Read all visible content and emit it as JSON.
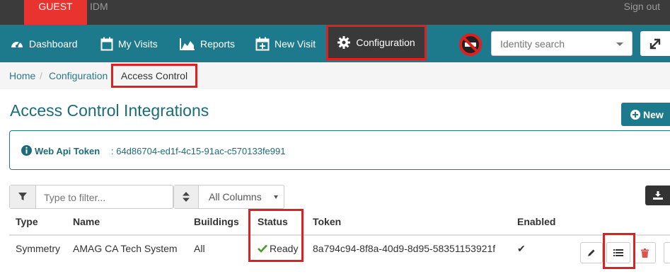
{
  "topbar": {
    "tabs": [
      "GUEST",
      "IDM"
    ],
    "signout": "Sign out"
  },
  "nav": {
    "items": [
      "Dashboard",
      "My Visits",
      "Reports",
      "New Visit",
      "Configuration"
    ],
    "search_placeholder": "Identity search"
  },
  "breadcrumb": [
    "Home",
    "Configuration",
    "Access Control"
  ],
  "page": {
    "title": "Access Control Integrations",
    "new_button": "New",
    "api_token_label": "Web Api Token",
    "api_token_value": ": 64d86704-ed1f-4c15-91ac-c570133fe991"
  },
  "filter": {
    "placeholder": "Type to filter...",
    "columns_select": "All Columns"
  },
  "table": {
    "headers": [
      "Type",
      "Name",
      "Buildings",
      "Status",
      "Token",
      "Enabled"
    ],
    "rows": [
      {
        "type": "Symmetry",
        "name": "AMAG CA Tech System",
        "buildings": "All",
        "status": "Ready",
        "token": "8a794c94-8f8a-40d9-8d95-58351153921f",
        "enabled": "✔"
      }
    ]
  },
  "colors": {
    "topbar": "#3b3b3b",
    "guest_tab": "#e8332e",
    "navbar": "#1d7a8c",
    "highlight": "#e02020",
    "teal_text": "#1d6b78"
  }
}
